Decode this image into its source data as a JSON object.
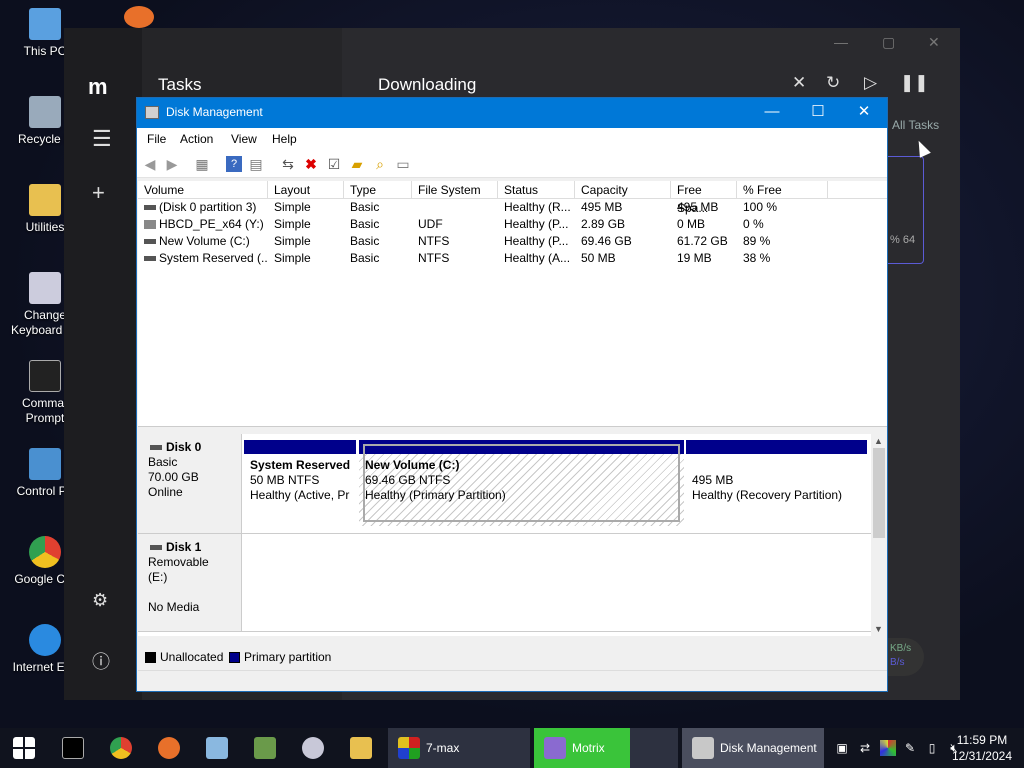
{
  "desktop": {
    "icons": [
      {
        "label": "This PC",
        "icon": "this-pc-icon",
        "color": "#5aa0e0"
      },
      {
        "label": "Recycle B",
        "icon": "recycle-bin-icon",
        "color": "#9ab"
      },
      {
        "label": "Utilities",
        "icon": "folder-icon",
        "color": "#e8c050"
      },
      {
        "label": "Change\nKeyboard La",
        "icon": "keyboard-settings-icon",
        "color": "#ccd"
      },
      {
        "label": "Commar\nPrompt",
        "icon": "command-prompt-icon",
        "color": "#222"
      },
      {
        "label": "Control Pa",
        "icon": "control-panel-icon",
        "color": "#4a90d0"
      },
      {
        "label": "Google Chr",
        "icon": "chrome-icon",
        "color": "#e04030"
      },
      {
        "label": "Internet Exp",
        "icon": "internet-explorer-icon",
        "color": "#2a8ae0"
      }
    ]
  },
  "motrix": {
    "logo": "m",
    "tasks_title": "Tasks",
    "list_title": "Downloading",
    "all_tasks": "All Tasks",
    "card_pct": "% 64",
    "speed_unit": "KB/s",
    "speed_val": "B/s"
  },
  "dm": {
    "title": "Disk Management",
    "menu": [
      "File",
      "Action",
      "View",
      "Help"
    ],
    "columns": [
      "Volume",
      "Layout",
      "Type",
      "File System",
      "Status",
      "Capacity",
      "Free Spa...",
      "% Free"
    ],
    "rows": [
      [
        "(Disk 0 partition 3)",
        "Simple",
        "Basic",
        "",
        "Healthy (R...",
        "495 MB",
        "495 MB",
        "100 %"
      ],
      [
        "HBCD_PE_x64 (Y:)",
        "Simple",
        "Basic",
        "UDF",
        "Healthy (P...",
        "2.89 GB",
        "0 MB",
        "0 %"
      ],
      [
        "New Volume (C:)",
        "Simple",
        "Basic",
        "NTFS",
        "Healthy (P...",
        "69.46 GB",
        "61.72 GB",
        "89 %"
      ],
      [
        "System Reserved (...",
        "Simple",
        "Basic",
        "NTFS",
        "Healthy (A...",
        "50 MB",
        "19 MB",
        "38 %"
      ]
    ],
    "disk0": {
      "name": "Disk 0",
      "type": "Basic",
      "size": "70.00 GB",
      "state": "Online",
      "partitions": [
        {
          "title": "System Reserved",
          "size": "50 MB NTFS",
          "status": "Healthy (Active, Pr"
        },
        {
          "title": "New Volume  (C:)",
          "size": "69.46 GB NTFS",
          "status": "Healthy (Primary Partition)"
        },
        {
          "title": "",
          "size": "495 MB",
          "status": "Healthy (Recovery Partition)"
        }
      ]
    },
    "disk1": {
      "name": "Disk 1",
      "type": "Removable (E:)",
      "state": "No Media"
    },
    "legend": {
      "unallocated": "Unallocated",
      "primary": "Primary partition",
      "unallocated_color": "#000000",
      "primary_color": "#00008b"
    }
  },
  "taskbar": {
    "apps": [
      {
        "label": "7-max",
        "icon": "7-max-icon"
      },
      {
        "label": "Motrix",
        "icon": "motrix-icon"
      },
      {
        "label": "Disk Management",
        "icon": "disk-management-icon"
      }
    ],
    "time": "11:59 PM",
    "date": "12/31/2024"
  }
}
